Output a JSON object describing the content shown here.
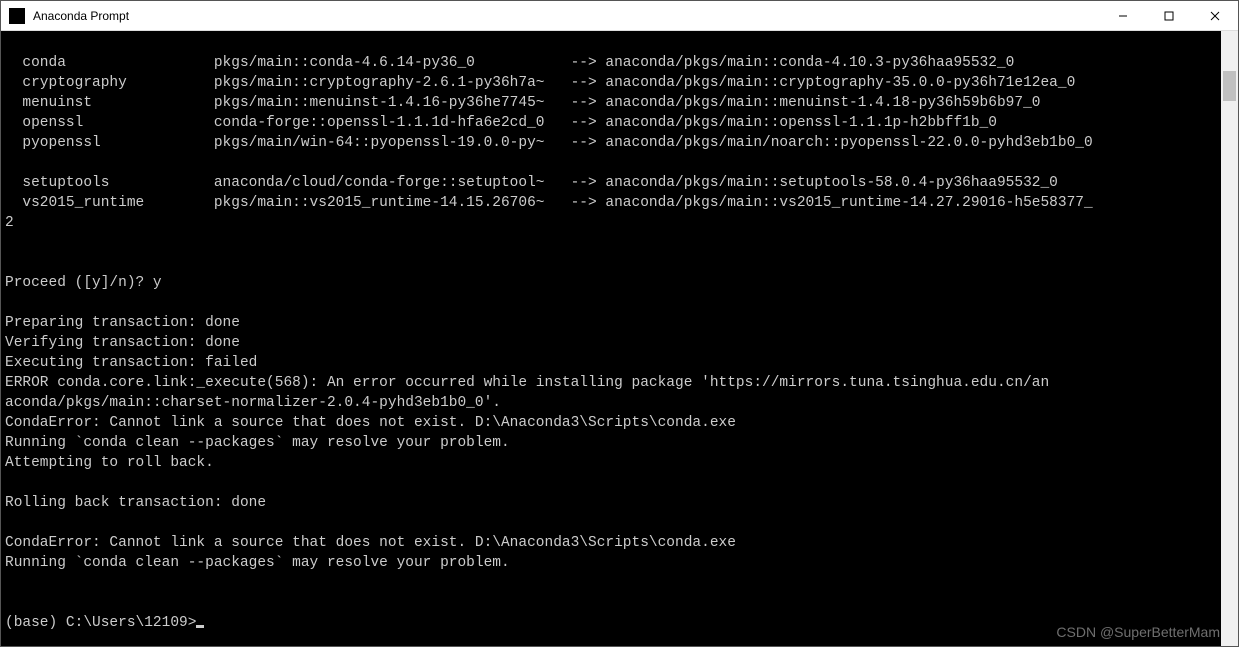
{
  "window": {
    "title": "Anaconda Prompt"
  },
  "blank1": "",
  "packages_indent": "  ",
  "pkgs": [
    {
      "name": "conda",
      "from": "pkgs/main::conda-4.6.14-py36_0",
      "to": "anaconda/pkgs/main::conda-4.10.3-py36haa95532_0"
    },
    {
      "name": "cryptography",
      "from": "pkgs/main::cryptography-2.6.1-py36h7a~",
      "to": "anaconda/pkgs/main::cryptography-35.0.0-py36h71e12ea_0"
    },
    {
      "name": "menuinst",
      "from": "pkgs/main::menuinst-1.4.16-py36he7745~",
      "to": "anaconda/pkgs/main::menuinst-1.4.18-py36h59b6b97_0"
    },
    {
      "name": "openssl",
      "from": "conda-forge::openssl-1.1.1d-hfa6e2cd_0",
      "to": "anaconda/pkgs/main::openssl-1.1.1p-h2bbff1b_0"
    },
    {
      "name": "pyopenssl",
      "from": "pkgs/main/win-64::pyopenssl-19.0.0-py~",
      "to": "anaconda/pkgs/main/noarch::pyopenssl-22.0.0-pyhd3eb1b0_0"
    }
  ],
  "pkgs2": [
    {
      "name": "setuptools",
      "from": "anaconda/cloud/conda-forge::setuptool~",
      "to": "anaconda/pkgs/main::setuptools-58.0.4-py36haa95532_0"
    },
    {
      "name": "vs2015_runtime",
      "from": "pkgs/main::vs2015_runtime-14.15.26706~",
      "to": "anaconda/pkgs/main::vs2015_runtime-14.27.29016-h5e58377_"
    }
  ],
  "wrap2": "2",
  "blank2": "",
  "blank3": "",
  "proceed": "Proceed ([y]/n)? y",
  "blank4": "",
  "prep": "Preparing transaction: done",
  "verify": "Verifying transaction: done",
  "exec": "Executing transaction: failed",
  "err1": "ERROR conda.core.link:_execute(568): An error occurred while installing package 'https://mirrors.tuna.tsinghua.edu.cn/an",
  "err1b": "aconda/pkgs/main::charset-normalizer-2.0.4-pyhd3eb1b0_0'.",
  "err2": "CondaError: Cannot link a source that does not exist. D:\\Anaconda3\\Scripts\\conda.exe",
  "err3": "Running `conda clean --packages` may resolve your problem.",
  "err4": "Attempting to roll back.",
  "blank5": "",
  "roll": "Rolling back transaction: done",
  "blank6": "",
  "err5": "CondaError: Cannot link a source that does not exist. D:\\Anaconda3\\Scripts\\conda.exe",
  "err6": "Running `conda clean --packages` may resolve your problem.",
  "blank7": "",
  "blank8": "",
  "prompt": "(base) C:\\Users\\12109>",
  "watermark": "CSDN @SuperBetterMam"
}
